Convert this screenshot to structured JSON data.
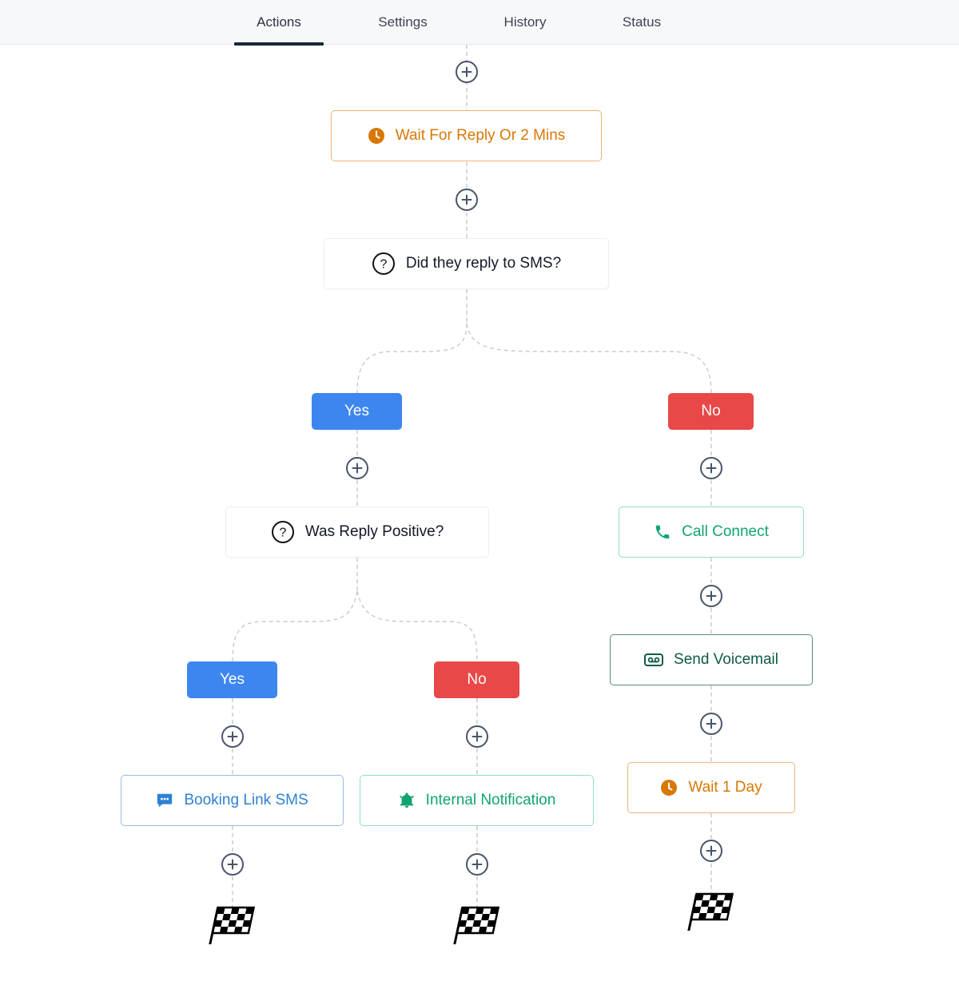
{
  "tabs": [
    {
      "label": "Actions",
      "active": true
    },
    {
      "label": "Settings",
      "active": false
    },
    {
      "label": "History",
      "active": false
    },
    {
      "label": "Status",
      "active": false
    }
  ],
  "workflow": {
    "wait_reply": {
      "label": "Wait For Reply Or 2 Mins",
      "icon": "clock-icon"
    },
    "condition_reply": {
      "label": "Did they reply to SMS?",
      "icon": "question-icon"
    },
    "branch_yes": {
      "label": "Yes"
    },
    "branch_no": {
      "label": "No"
    },
    "condition_positive": {
      "label": "Was Reply Positive?",
      "icon": "question-icon"
    },
    "branch_yes_2": {
      "label": "Yes"
    },
    "branch_no_2": {
      "label": "No"
    },
    "call_connect": {
      "label": "Call Connect",
      "icon": "phone-icon"
    },
    "send_voicemail": {
      "label": "Send Voicemail",
      "icon": "voicemail-icon"
    },
    "wait_day": {
      "label": "Wait 1 Day",
      "icon": "clock-icon"
    },
    "booking_sms": {
      "label": "Booking Link SMS",
      "icon": "chat-icon"
    },
    "internal_notification": {
      "label": "Internal Notification",
      "icon": "bell-icon"
    },
    "end_icon": "checkered-flag-icon"
  },
  "colors": {
    "yes": "#3d86f0",
    "no": "#e94848",
    "wait": "#d97706",
    "call": "#10a374",
    "voicemail": "#0f5a45",
    "sms": "#2f80d1",
    "tab_indicator": "#17273a"
  }
}
